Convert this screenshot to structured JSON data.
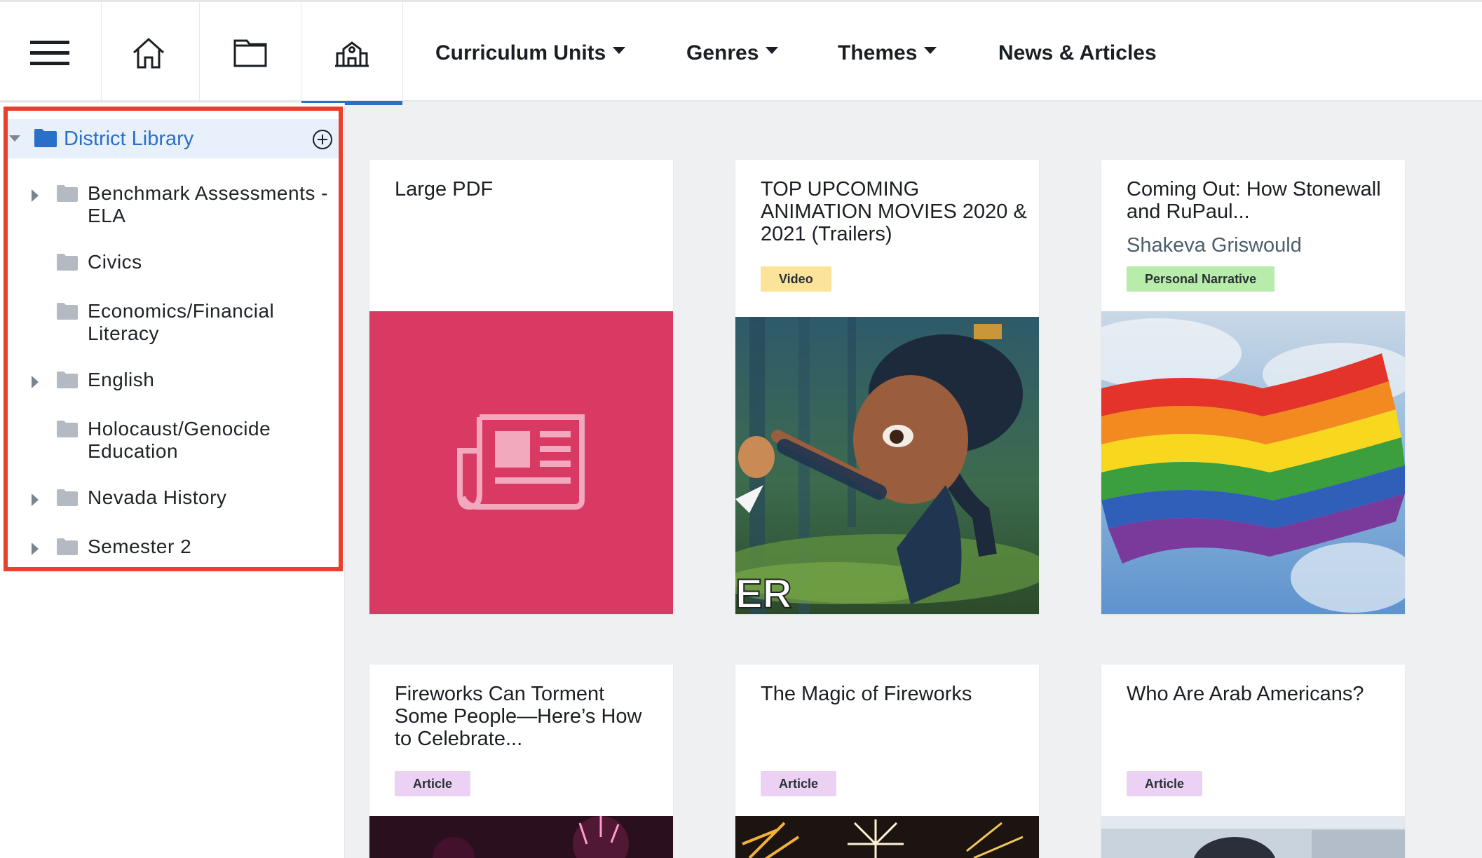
{
  "nav": {
    "items": [
      {
        "label": "Curriculum Units",
        "has_menu": true
      },
      {
        "label": "Genres",
        "has_menu": true
      },
      {
        "label": "Themes",
        "has_menu": true
      },
      {
        "label": "News & Articles",
        "has_menu": false
      }
    ],
    "icons": [
      "menu-icon",
      "home-icon",
      "folder-icon",
      "school-icon"
    ],
    "active_icon": "school-icon",
    "accent": "#2a6fc9"
  },
  "sidebar": {
    "root": {
      "label": "District Library",
      "expanded": true
    },
    "items": [
      {
        "label": "Benchmark Assessments - ELA",
        "has_children": true
      },
      {
        "label": "Civics",
        "has_children": false
      },
      {
        "label": "Economics/Financial Literacy",
        "has_children": false
      },
      {
        "label": "English",
        "has_children": true
      },
      {
        "label": "Holocaust/Genocide Education",
        "has_children": false
      },
      {
        "label": "Nevada History",
        "has_children": true
      },
      {
        "label": "Semester 2",
        "has_children": true
      }
    ],
    "highlight_color": "#e8402a"
  },
  "cards": [
    {
      "title": "Large PDF",
      "author": "",
      "badge": "",
      "media": "newspaper-icon",
      "media_color": "#d93a63"
    },
    {
      "title": "TOP UPCOMING ANIMATION MOVIES 2020 & 2021 (Trailers)",
      "author": "",
      "badge": "Video",
      "badge_color": "#fbe49a",
      "media": "animation-thumbnail",
      "media_text": "ER"
    },
    {
      "title": "Coming Out: How Stonewall and RuPaul...",
      "author": "Shakeva Griswould",
      "badge": "Personal Narrative",
      "badge_color": "#b8ecaa",
      "media": "rainbow-flag-photo"
    },
    {
      "title": "Fireworks Can Torment Some People—Here’s How to Celebrate...",
      "author": "",
      "badge": "Article",
      "badge_color": "#ebd2f4",
      "media": "fireworks-photo"
    },
    {
      "title": "The Magic of Fireworks",
      "author": "",
      "badge": "Article",
      "badge_color": "#ebd2f4",
      "media": "fireworks-photo"
    },
    {
      "title": "Who Are Arab Americans?",
      "author": "",
      "badge": "Article",
      "badge_color": "#ebd2f4",
      "media": "people-photo"
    }
  ]
}
